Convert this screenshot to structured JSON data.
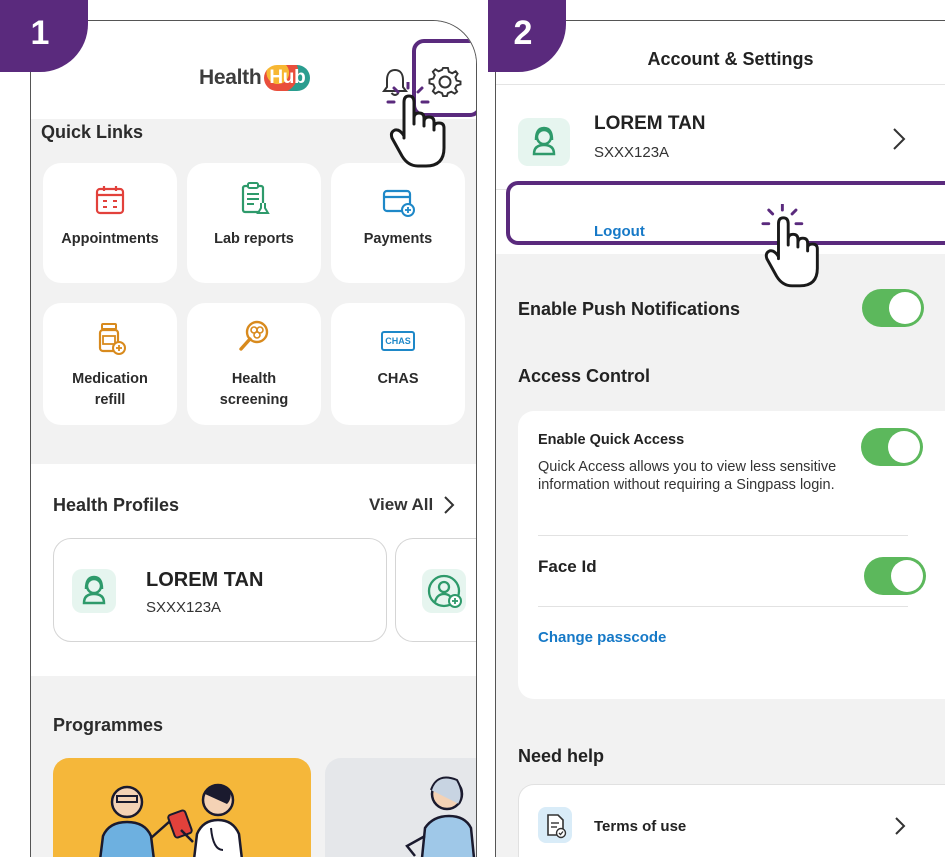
{
  "steps": [
    "1",
    "2"
  ],
  "screen1": {
    "logo_prefix": "Health",
    "logo_suffix": "Hub",
    "quick_links_title": "Quick Links",
    "tiles": [
      {
        "label": "Appointments",
        "icon": "calendar-icon"
      },
      {
        "label": "Lab reports",
        "icon": "clipboard-icon"
      },
      {
        "label": "Payments",
        "icon": "card-icon"
      },
      {
        "label_line1": "Medication",
        "label_line2": "refill",
        "icon": "medicine-bottle-icon"
      },
      {
        "label_line1": "Health",
        "label_line2": "screening",
        "icon": "magnifier-icon"
      },
      {
        "label": "CHAS",
        "icon": "chas-icon",
        "icon_text": "CHAS"
      }
    ],
    "health_profiles_title": "Health Profiles",
    "view_all": "View All",
    "profile": {
      "name": "LOREM TAN",
      "nric": "SXXX123A"
    },
    "programmes_title": "Programmes"
  },
  "screen2": {
    "title": "Account & Settings",
    "profile": {
      "name": "LOREM TAN",
      "nric": "SXXX123A"
    },
    "logout": "Logout",
    "push_notifications": {
      "label": "Enable Push Notifications",
      "enabled": true
    },
    "access_control_title": "Access Control",
    "quick_access": {
      "label": "Enable Quick Access",
      "description": "Quick Access allows you to view less sensitive information without requiring a Singpass login.",
      "enabled": true
    },
    "face_id": {
      "label": "Face Id",
      "enabled": true
    },
    "change_passcode": "Change passcode",
    "need_help_title": "Need help",
    "terms": "Terms of use"
  },
  "colors": {
    "highlight": "#5a2a7d",
    "toggle_on": "#5cb85c",
    "link": "#1679c7",
    "icon_red": "#e2413b",
    "icon_green": "#2e9a6b",
    "icon_blue": "#1e88c8",
    "icon_orange": "#d88a1d"
  }
}
